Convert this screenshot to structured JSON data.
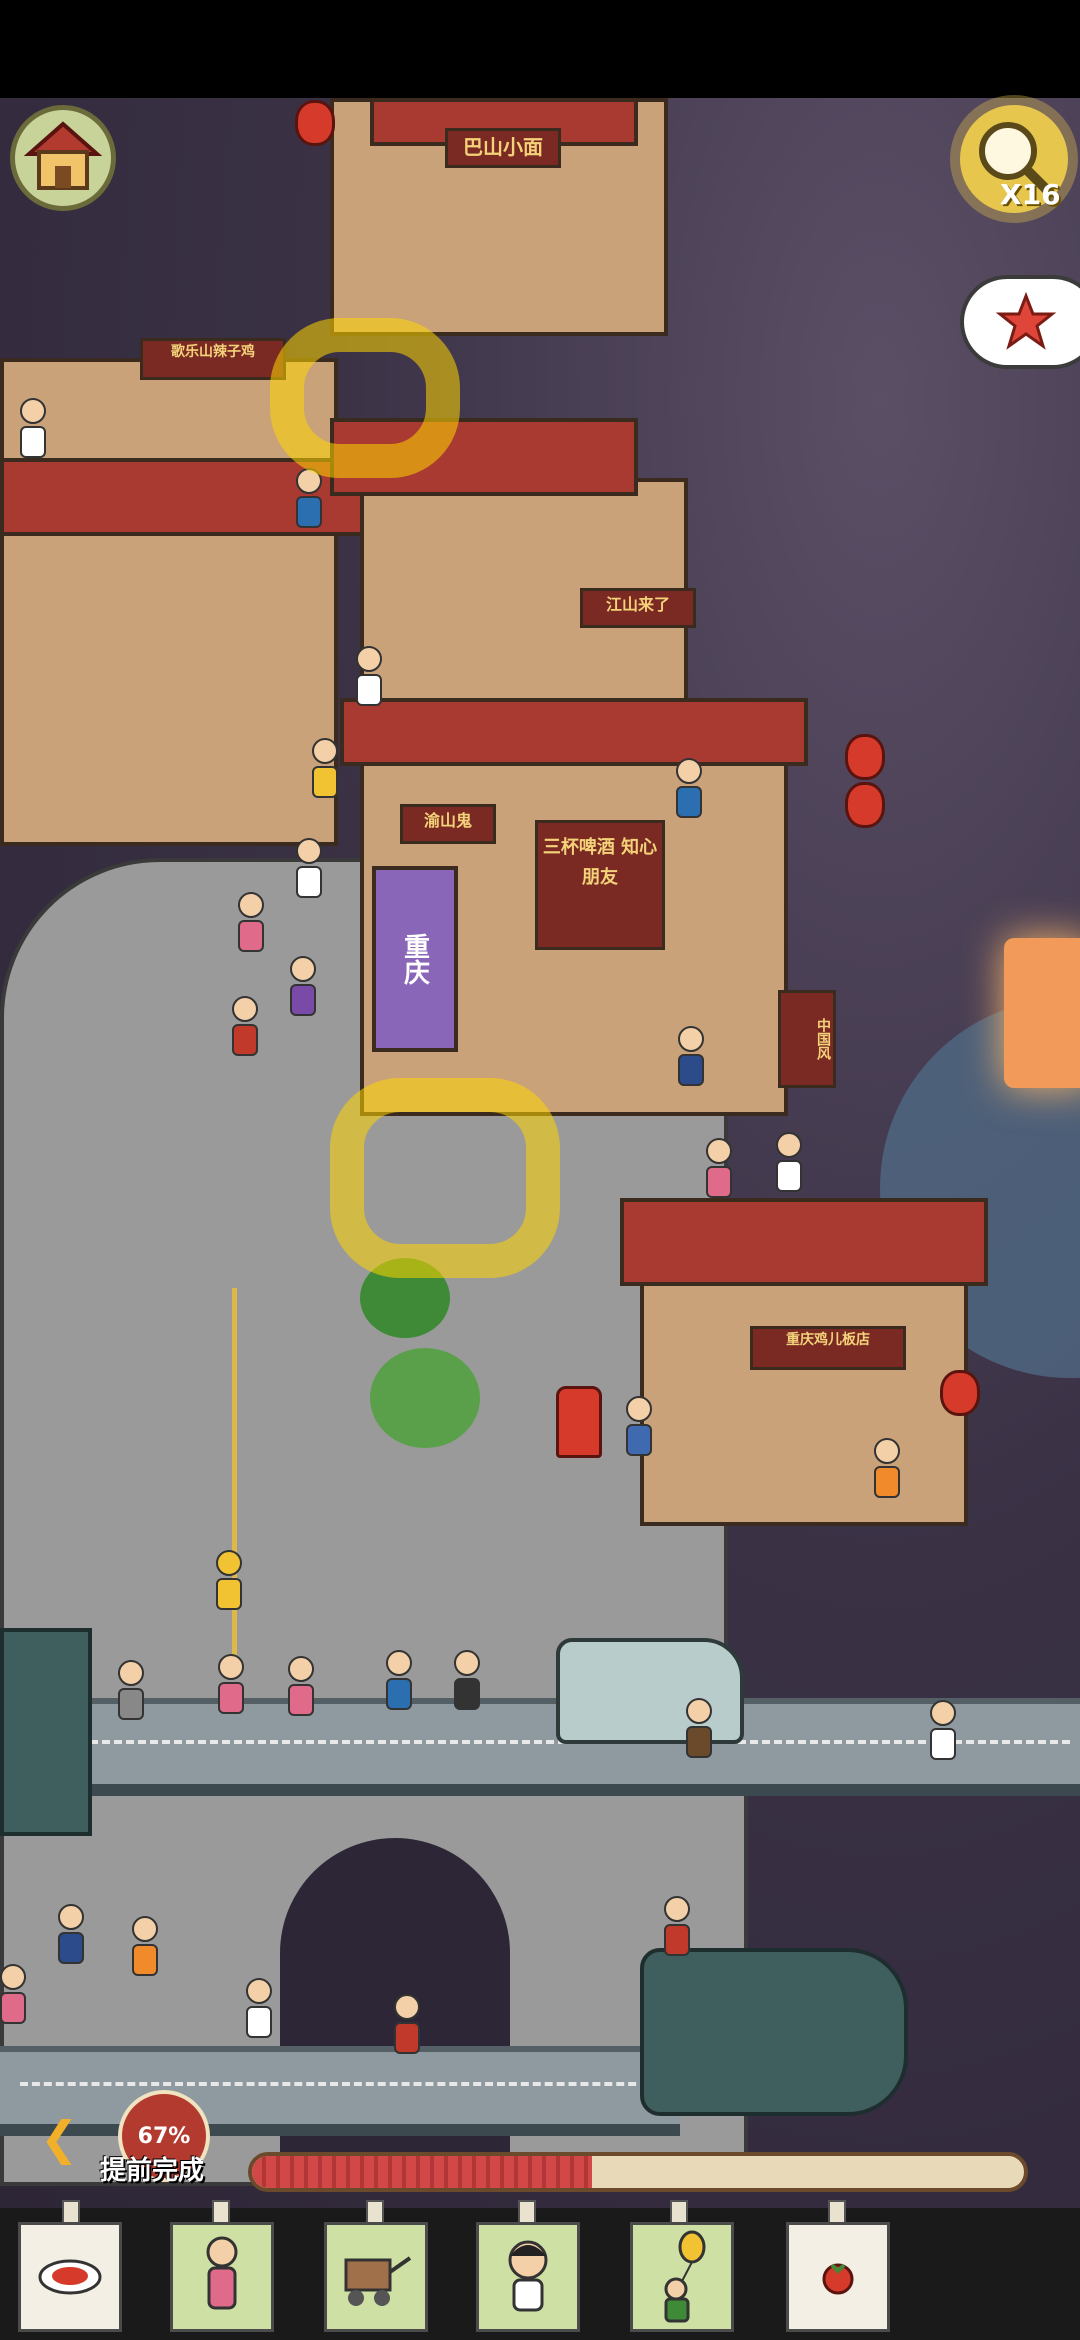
{
  "game": {
    "hud": {
      "home_icon": "house-icon",
      "magnifier_icon": "magnifier-icon",
      "magnifier_count": "X16",
      "star_icon": "star-icon",
      "progress_percent_label": "67%",
      "progress_fraction": 0.44,
      "early_finish_label": "提前完成",
      "back_icon": "chevron-left-icon"
    },
    "signs": {
      "top_house": "巴山小面",
      "left_house": "歌乐山辣子鸡",
      "middle_left": "江山来了",
      "chongqing": "重庆",
      "yushan": "渝山鬼",
      "beer": "三杯啤酒 知心朋友",
      "right_vertical": "中国风",
      "bottom_house": "重庆鸡儿板店"
    },
    "items_tray": [
      {
        "name": "noodle-plate-item",
        "icon": "plate-icon"
      },
      {
        "name": "nurse-girl-item",
        "icon": "girl-icon"
      },
      {
        "name": "cart-item",
        "icon": "cart-icon"
      },
      {
        "name": "kid-item",
        "icon": "boy-icon"
      },
      {
        "name": "balloon-kid-item",
        "icon": "balloon-icon"
      },
      {
        "name": "tomato-item",
        "icon": "tomato-icon"
      }
    ],
    "colors": {
      "accent_yellow": "#e7c64e",
      "roof_red": "#a83a32",
      "progress_red": "#d24848"
    }
  }
}
